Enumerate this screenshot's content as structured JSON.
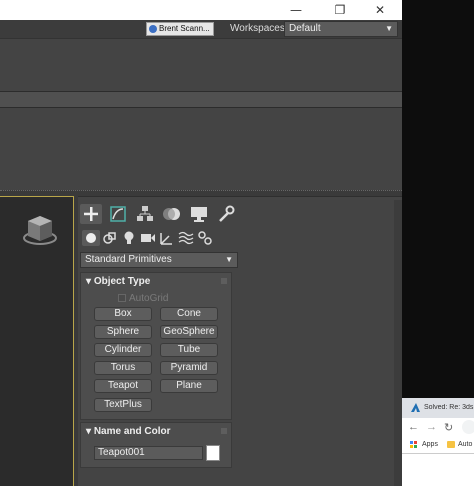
{
  "titlebar": {
    "minimize": "—",
    "restore": "❐",
    "close": "✕"
  },
  "menu": {
    "user_label": "Brent Scann...",
    "workspaces_label": "Workspaces:",
    "workspaces_value": "Default"
  },
  "command_panel": {
    "tabs": [
      "create-icon",
      "modify-icon",
      "hierarchy-icon",
      "motion-icon",
      "display-icon",
      "utilities-icon"
    ],
    "categories": [
      "geometry-icon",
      "shapes-icon",
      "lights-icon",
      "cameras-icon",
      "helpers-icon",
      "spacewarps-icon",
      "systems-icon"
    ],
    "primitive_dropdown": "Standard Primitives",
    "object_type": {
      "header": "Object Type",
      "autogrid": "AutoGrid",
      "buttons": [
        "Box",
        "Cone",
        "Sphere",
        "GeoSphere",
        "Cylinder",
        "Tube",
        "Torus",
        "Pyramid",
        "Teapot",
        "Plane",
        "TextPlus"
      ]
    },
    "name_and_color": {
      "header": "Name and Color",
      "name_value": "Teapot001",
      "color": "#ffffff"
    }
  },
  "browser": {
    "tab_title": "Solved: Re: 3ds",
    "bookmark_apps": "Apps",
    "bookmark_2": "Auto"
  },
  "colors": {
    "viewport_border": "#b9a64a",
    "panel_bg": "#444444",
    "accent_blue": "#3b6fc3"
  }
}
